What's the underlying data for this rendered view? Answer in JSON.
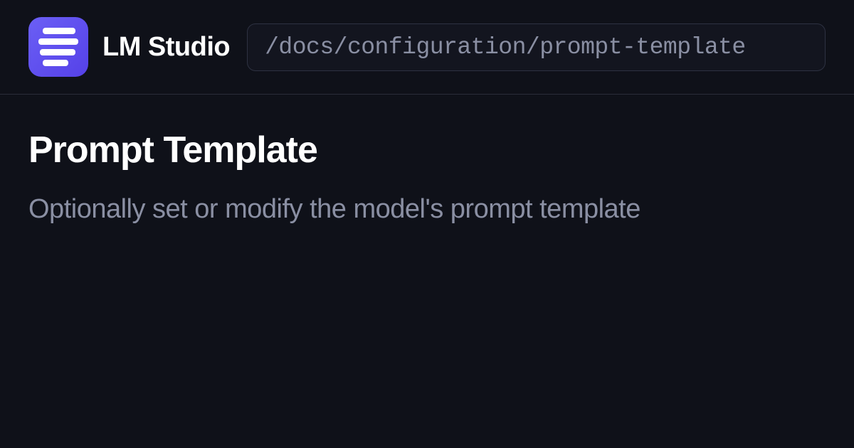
{
  "header": {
    "app_name": "LM Studio",
    "path": "/docs/configuration/prompt-template"
  },
  "content": {
    "title": "Prompt Template",
    "description": "Optionally set or modify the model's prompt template"
  }
}
